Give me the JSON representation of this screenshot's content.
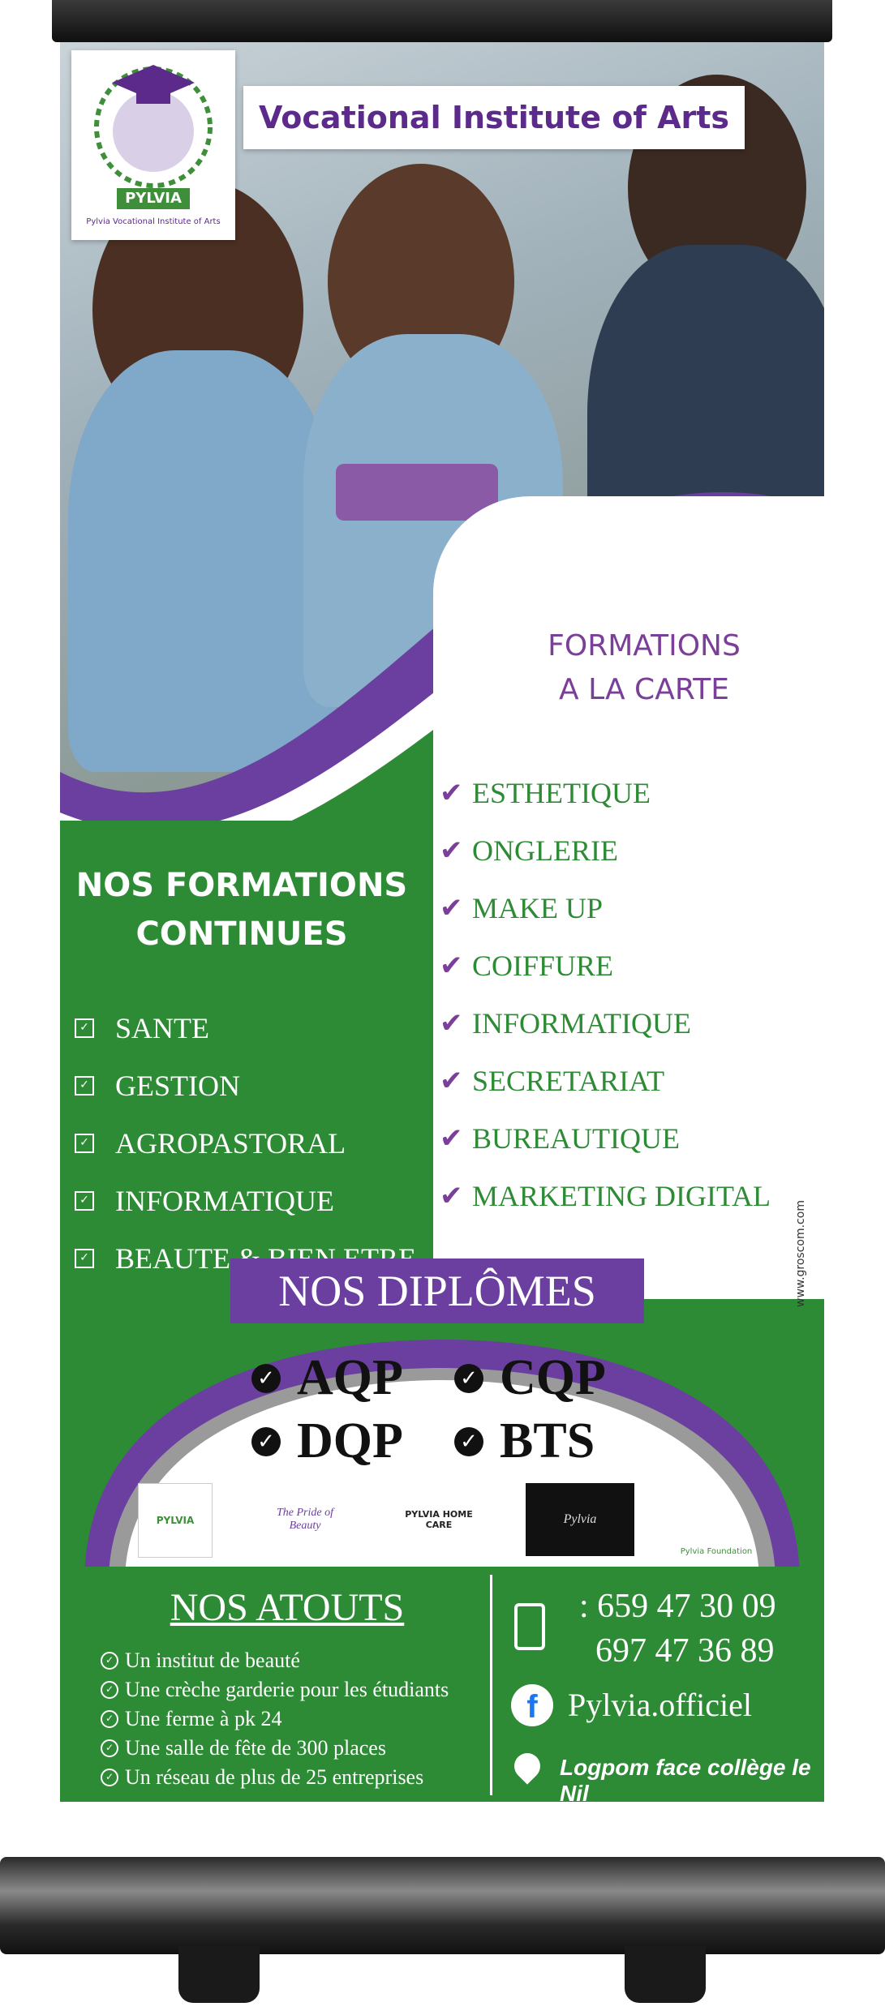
{
  "header": {
    "title": "Vocational Institute of Arts",
    "logo_name": "PYLVIA",
    "logo_caption": "Pylvia Vocational Institute of Arts"
  },
  "formations_carte": {
    "title_line1": "FORMATIONS",
    "title_line2": "A LA CARTE",
    "items": [
      "ESTHETIQUE",
      "ONGLERIE",
      "MAKE UP",
      "COIFFURE",
      "INFORMATIQUE",
      "SECRETARIAT",
      "BUREAUTIQUE",
      "MARKETING DIGITAL"
    ]
  },
  "formations_continues": {
    "title_line1": "NOS FORMATIONS",
    "title_line2": "CONTINUES",
    "items": [
      "SANTE",
      "GESTION",
      "AGROPASTORAL",
      "INFORMATIQUE",
      "BEAUTE & BIEN ETRE"
    ]
  },
  "diplomes": {
    "title": "NOS DIPLÔMES",
    "items": [
      "AQP",
      "CQP",
      "DQP",
      "BTS"
    ]
  },
  "partners": {
    "items": [
      "PYLVIA",
      "The Pride of Beauty",
      "PYLVIA HOME CARE",
      "Pylvia",
      "Pylvia Foundation"
    ]
  },
  "atouts": {
    "title": "NOS ATOUTS",
    "items": [
      "Un institut de beauté",
      "Une crèche garderie pour les étudiants",
      "Une ferme à pk 24",
      "Une salle de fête de 300 places",
      "Un réseau de plus de 25 entreprises"
    ]
  },
  "contact": {
    "phone1": ": 659 47 30 09",
    "phone2": "697 47 36 89",
    "facebook": "Pylvia.officiel",
    "address": "Logpom face collège le Nil"
  },
  "credit": "www.groscom.com",
  "colors": {
    "green": "#2e8b35",
    "purple": "#6b3fa0",
    "white": "#ffffff"
  },
  "icons": [
    "graduation-cap-icon",
    "check-icon",
    "checkbox-icon",
    "phone-icon",
    "facebook-icon",
    "location-pin-icon"
  ]
}
